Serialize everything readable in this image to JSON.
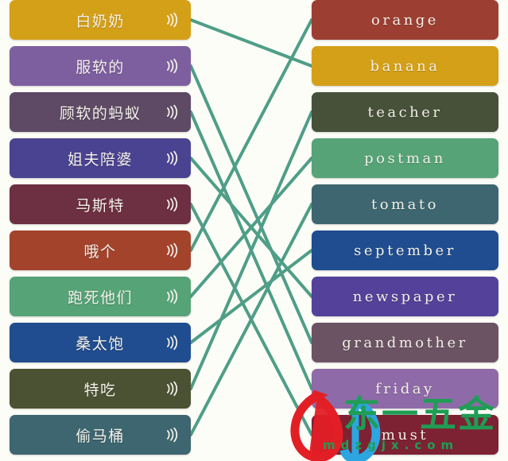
{
  "exercise": {
    "type": "matching-pairs",
    "left_column": {
      "name": "chinese-mnemonic-column",
      "items": [
        {
          "label": "白奶奶",
          "color": "#d4a017",
          "icon": "speaker-icon"
        },
        {
          "label": "服软的",
          "color": "#7d5fa0",
          "icon": "speaker-icon"
        },
        {
          "label": "顾软的蚂蚁",
          "color": "#5e4a65",
          "icon": "speaker-icon"
        },
        {
          "label": "姐夫陪婆",
          "color": "#4a4391",
          "icon": "speaker-icon"
        },
        {
          "label": "马斯特",
          "color": "#6d2f42",
          "icon": "speaker-icon"
        },
        {
          "label": "哦个",
          "color": "#a3432c",
          "icon": "speaker-icon"
        },
        {
          "label": "跑死他们",
          "color": "#55a377",
          "icon": "speaker-icon"
        },
        {
          "label": "桑太饱",
          "color": "#1f4d8f",
          "icon": "speaker-icon"
        },
        {
          "label": "特吃",
          "color": "#4b5233",
          "icon": "speaker-icon"
        },
        {
          "label": "偷马桶",
          "color": "#3d6670",
          "icon": "speaker-icon"
        }
      ]
    },
    "right_column": {
      "name": "english-word-column",
      "items": [
        {
          "label": "orange",
          "color": "#9c3f32"
        },
        {
          "label": "banana",
          "color": "#d4a017"
        },
        {
          "label": "teacher",
          "color": "#47513a"
        },
        {
          "label": "postman",
          "color": "#55a377"
        },
        {
          "label": "tomato",
          "color": "#3d6670"
        },
        {
          "label": "september",
          "color": "#1f4d8f"
        },
        {
          "label": "newspaper",
          "color": "#54419a"
        },
        {
          "label": "grandmother",
          "color": "#6b5364"
        },
        {
          "label": "friday",
          "color": "#8f6aa8"
        },
        {
          "label": "must",
          "color": "#7d2233"
        }
      ]
    },
    "connections": [
      {
        "from": 0,
        "to": 1
      },
      {
        "from": 1,
        "to": 7
      },
      {
        "from": 2,
        "to": 8
      },
      {
        "from": 3,
        "to": 6
      },
      {
        "from": 4,
        "to": 9
      },
      {
        "from": 5,
        "to": 0
      },
      {
        "from": 6,
        "to": 3
      },
      {
        "from": 7,
        "to": 5
      },
      {
        "from": 8,
        "to": 2
      },
      {
        "from": 9,
        "to": 4
      }
    ],
    "line_color": "#4f9e87"
  },
  "watermark": {
    "brand_text": "东一五金",
    "domain_text": "mdzgjx.com",
    "logo_red": "#e31f26",
    "logo_blue": "#2ba6e0",
    "green": "#1f9d55"
  }
}
